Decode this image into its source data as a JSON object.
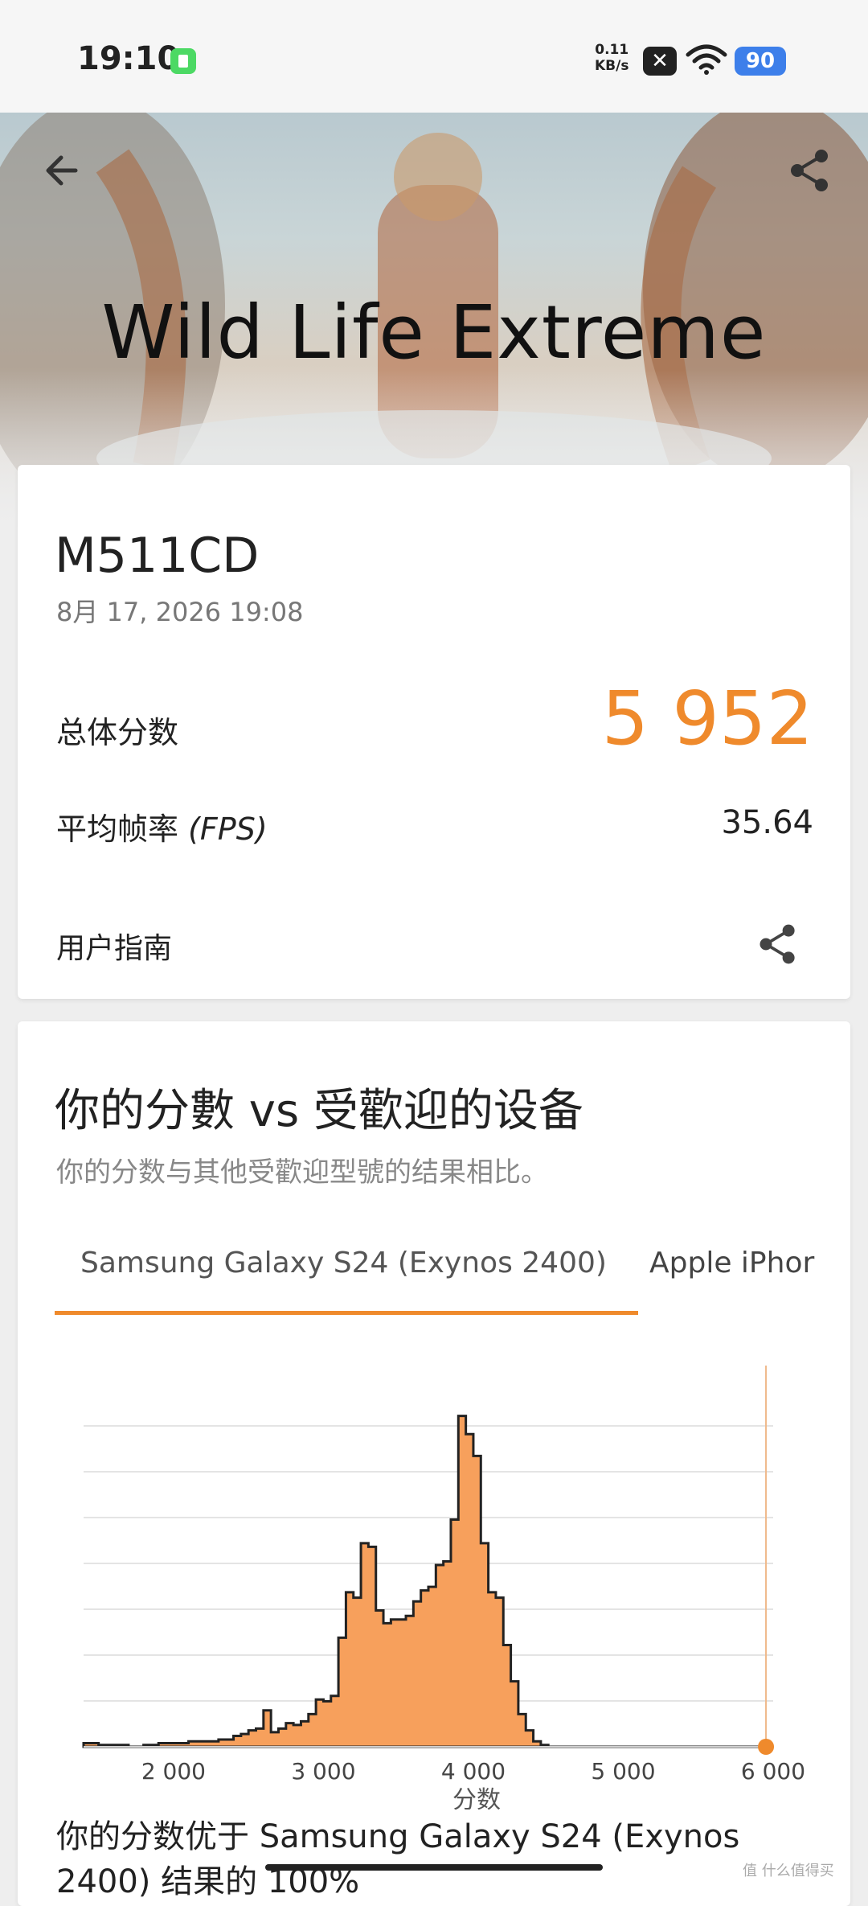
{
  "status_bar": {
    "time": "19:10",
    "net_speed_value": "0.11",
    "net_speed_unit": "KB/s",
    "battery": "90",
    "icons": [
      "battery-saver-icon",
      "no-sim-icon",
      "wifi-icon",
      "battery-icon"
    ]
  },
  "header": {
    "title": "Wild Life Extreme",
    "back_icon": "arrow-left-icon",
    "share_icon": "share-icon"
  },
  "result": {
    "device": "M511CD",
    "datetime": "8月 17, 2026 19:08",
    "score_label": "总体分数",
    "score": "5 952",
    "fps_label": "平均帧率",
    "fps_unit": "(FPS)",
    "fps": "35.64",
    "guide_label": "用户指南"
  },
  "comparison": {
    "title": "你的分數 vs 受歡迎的设备",
    "subtitle": "你的分数与其他受歡迎型號的结果相比。",
    "tabs": [
      {
        "label": "Samsung Galaxy S24 (Exynos 2400)",
        "active": true
      },
      {
        "label": "Apple iPhor",
        "active": false
      }
    ],
    "result_text": "你的分数优于 Samsung Galaxy S24 (Exynos 2400) 结果的 100%"
  },
  "chart_data": {
    "type": "area",
    "xlabel": "分数",
    "ylabel": "",
    "xticks": [
      "2 000",
      "3 000",
      "4 000",
      "5 000",
      "6 000"
    ],
    "xlim": [
      1400,
      6000
    ],
    "grid": true,
    "marker": {
      "x": 5952,
      "color": "#ef8a2c"
    },
    "fill_color": "#f7a05c",
    "x": [
      1400,
      1500,
      1600,
      1700,
      1800,
      1900,
      2000,
      2100,
      2200,
      2300,
      2400,
      2450,
      2500,
      2550,
      2600,
      2650,
      2700,
      2750,
      2800,
      2850,
      2900,
      2950,
      3000,
      3050,
      3100,
      3150,
      3200,
      3250,
      3300,
      3350,
      3400,
      3450,
      3500,
      3550,
      3600,
      3650,
      3700,
      3750,
      3800,
      3850,
      3900,
      3950,
      4000,
      4050,
      4100,
      4150,
      4200,
      4250,
      4300,
      4350,
      4400,
      4450,
      4500,
      4600,
      5000,
      6000
    ],
    "y": [
      2,
      1,
      1,
      0,
      1,
      2,
      2,
      3,
      3,
      4,
      6,
      7,
      9,
      10,
      20,
      8,
      10,
      13,
      12,
      14,
      18,
      26,
      25,
      28,
      60,
      85,
      82,
      112,
      110,
      75,
      68,
      70,
      70,
      72,
      80,
      86,
      88,
      100,
      102,
      125,
      182,
      172,
      160,
      112,
      85,
      82,
      56,
      36,
      18,
      9,
      3,
      1,
      0,
      0,
      0,
      0
    ]
  }
}
